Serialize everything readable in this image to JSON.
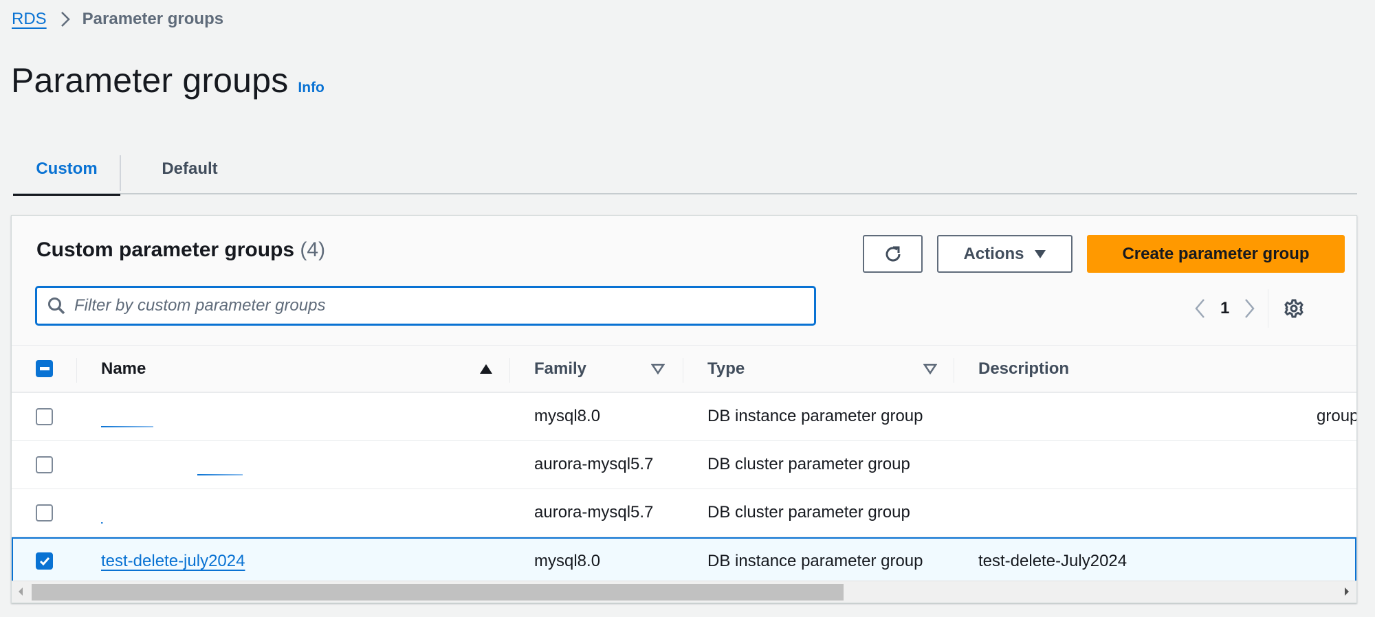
{
  "breadcrumb": {
    "items": [
      {
        "label": "RDS",
        "link": true
      },
      {
        "label": "Parameter groups",
        "link": false
      }
    ]
  },
  "header": {
    "title": "Parameter groups",
    "info_label": "Info"
  },
  "tabs": [
    {
      "label": "Custom",
      "active": true
    },
    {
      "label": "Default",
      "active": false
    }
  ],
  "container": {
    "title": "Custom parameter groups",
    "count": "(4)",
    "refresh_icon": "refresh-icon",
    "actions_label": "Actions",
    "create_label": "Create parameter group",
    "search": {
      "placeholder": "Filter by custom parameter groups",
      "value": ""
    },
    "pagination": {
      "current_page": "1"
    }
  },
  "table": {
    "columns": [
      {
        "label": "Name",
        "sort": "ascending"
      },
      {
        "label": "Family",
        "sort": "sortable"
      },
      {
        "label": "Type",
        "sort": "sortable"
      },
      {
        "label": "Description",
        "sort": "none"
      }
    ],
    "header_checkbox": "indeterminate",
    "rows": [
      {
        "name": "",
        "name_redacted": true,
        "family": "mysql8.0",
        "type": "DB instance parameter group",
        "description": "",
        "overflow_text": "group",
        "selected": false
      },
      {
        "name": "",
        "name_redacted": true,
        "family": "aurora-mysql5.7",
        "type": "DB cluster parameter group",
        "description": "",
        "overflow_text": "",
        "selected": false
      },
      {
        "name": "",
        "name_redacted": true,
        "family": "aurora-mysql5.7",
        "type": "DB cluster parameter group",
        "description": "",
        "overflow_text": "",
        "selected": false
      },
      {
        "name": "test-delete-july2024",
        "name_redacted": false,
        "family": "mysql8.0",
        "type": "DB instance parameter group",
        "description": "test-delete-July2024",
        "overflow_text": "",
        "selected": true
      }
    ]
  },
  "colors": {
    "accent": "#0972d3",
    "primary_button": "#ff9900",
    "selected_row_bg": "#f1faff"
  }
}
